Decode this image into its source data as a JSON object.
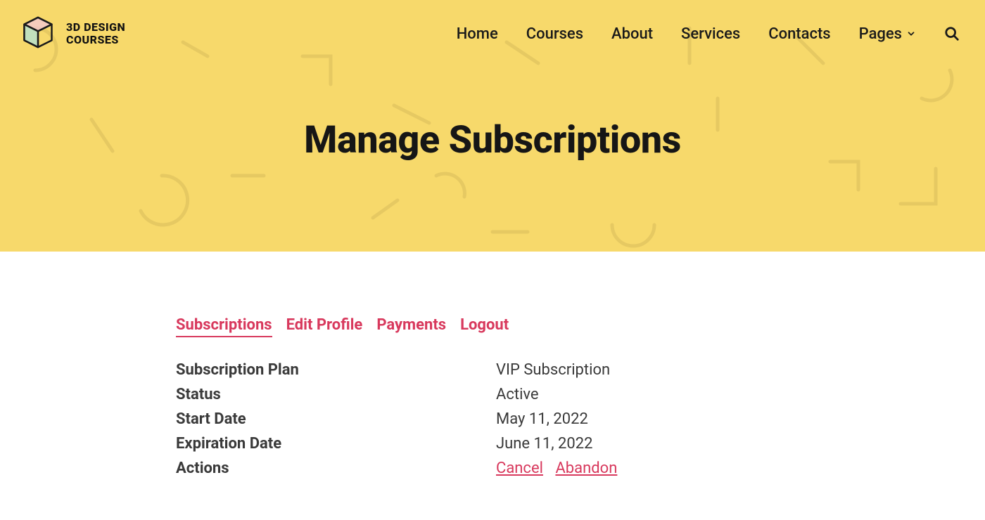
{
  "brand": {
    "line1": "3D DESIGN",
    "line2": "COURSES"
  },
  "nav": {
    "home": "Home",
    "courses": "Courses",
    "about": "About",
    "services": "Services",
    "contacts": "Contacts",
    "pages": "Pages"
  },
  "page_title": "Manage Subscriptions",
  "tabs": {
    "subscriptions": "Subscriptions",
    "edit_profile": "Edit Profile",
    "payments": "Payments",
    "logout": "Logout"
  },
  "subscription": {
    "plan_label": "Subscription Plan",
    "plan_value": "VIP Subscription",
    "status_label": "Status",
    "status_value": "Active",
    "start_label": "Start Date",
    "start_value": "May 11, 2022",
    "expire_label": "Expiration Date",
    "expire_value": "June 11, 2022",
    "actions_label": "Actions",
    "cancel": "Cancel",
    "abandon": "Abandon"
  },
  "colors": {
    "accent": "#d8395d",
    "hero_bg": "#f7d96b"
  }
}
